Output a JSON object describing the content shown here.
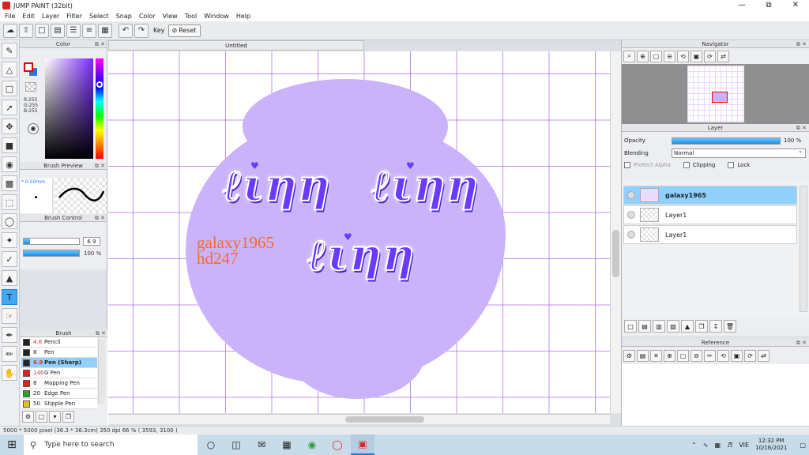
{
  "window": {
    "title": "JUMP PAINT (32bit)",
    "controls": [
      "—",
      "⧉",
      "✕"
    ]
  },
  "menu": [
    "File",
    "Edit",
    "Layer",
    "Filter",
    "Select",
    "Snap",
    "Color",
    "View",
    "Tool",
    "Window",
    "Help"
  ],
  "toolbar": {
    "key_label": "Key",
    "reset_label": "Reset"
  },
  "panels": {
    "color": {
      "title": "Color",
      "rgb_r": "R:255",
      "rgb_g": "G:255",
      "rgb_b": "B:255"
    },
    "brush_preview": {
      "title": "Brush Preview",
      "size": "* 0.50mm"
    },
    "brush_control": {
      "title": "Brush Control",
      "size_value": "6.9",
      "opacity_value": "100 %"
    },
    "brush": {
      "title": "Brush",
      "items": [
        {
          "size": "4.8",
          "name": "Pencil",
          "color": "#222222",
          "selected": false,
          "red": true
        },
        {
          "size": "8",
          "name": "Pen",
          "color": "#222222",
          "selected": false,
          "red": false
        },
        {
          "size": "6.9",
          "name": "Pen (Sharp)",
          "color": "#222222",
          "selected": true,
          "red": true
        },
        {
          "size": "146",
          "name": "G Pen",
          "color": "#e02020",
          "selected": false,
          "red": true
        },
        {
          "size": "8",
          "name": "Mapping Pen",
          "color": "#e02020",
          "selected": false,
          "red": false
        },
        {
          "size": "20",
          "name": "Edge Pen",
          "color": "#22aa22",
          "selected": false,
          "red": false
        },
        {
          "size": "50",
          "name": "Stipple Pen",
          "color": "#e0c020",
          "selected": false,
          "red": false
        }
      ]
    },
    "navigator": {
      "title": "Navigator"
    },
    "layer": {
      "title": "Layer",
      "opacity_label": "Opacity",
      "opacity_value": "100 %",
      "blending_label": "Blending",
      "blending_value": "Normal",
      "protect_alpha": "Protect Alpha",
      "clipping": "Clipping",
      "lock": "Lock",
      "layers": [
        {
          "name": "galaxy1965",
          "selected": true
        },
        {
          "name": "Layer1",
          "selected": false
        },
        {
          "name": "Layer1",
          "selected": false
        }
      ]
    },
    "reference": {
      "title": "Reference"
    }
  },
  "document": {
    "tab_title": "Untitled",
    "watermark_line1": "galaxy1965",
    "watermark_line2": "hd247"
  },
  "status": {
    "text": "5000 * 5000 pixel  (36.3 * 36.3cm)  350 dpi  66 %  ( 3593, 3100 )"
  },
  "taskbar": {
    "search_placeholder": "Type here to search",
    "language": "VIE",
    "time": "12:32 PM",
    "date": "10/16/2021"
  },
  "colors": {
    "accent": "#3fa9f5",
    "selection": "#8fd0ff",
    "canvas_blob": "#cbb3fb",
    "lettering": "#6a3bff",
    "watermark": "#f26b2e"
  }
}
